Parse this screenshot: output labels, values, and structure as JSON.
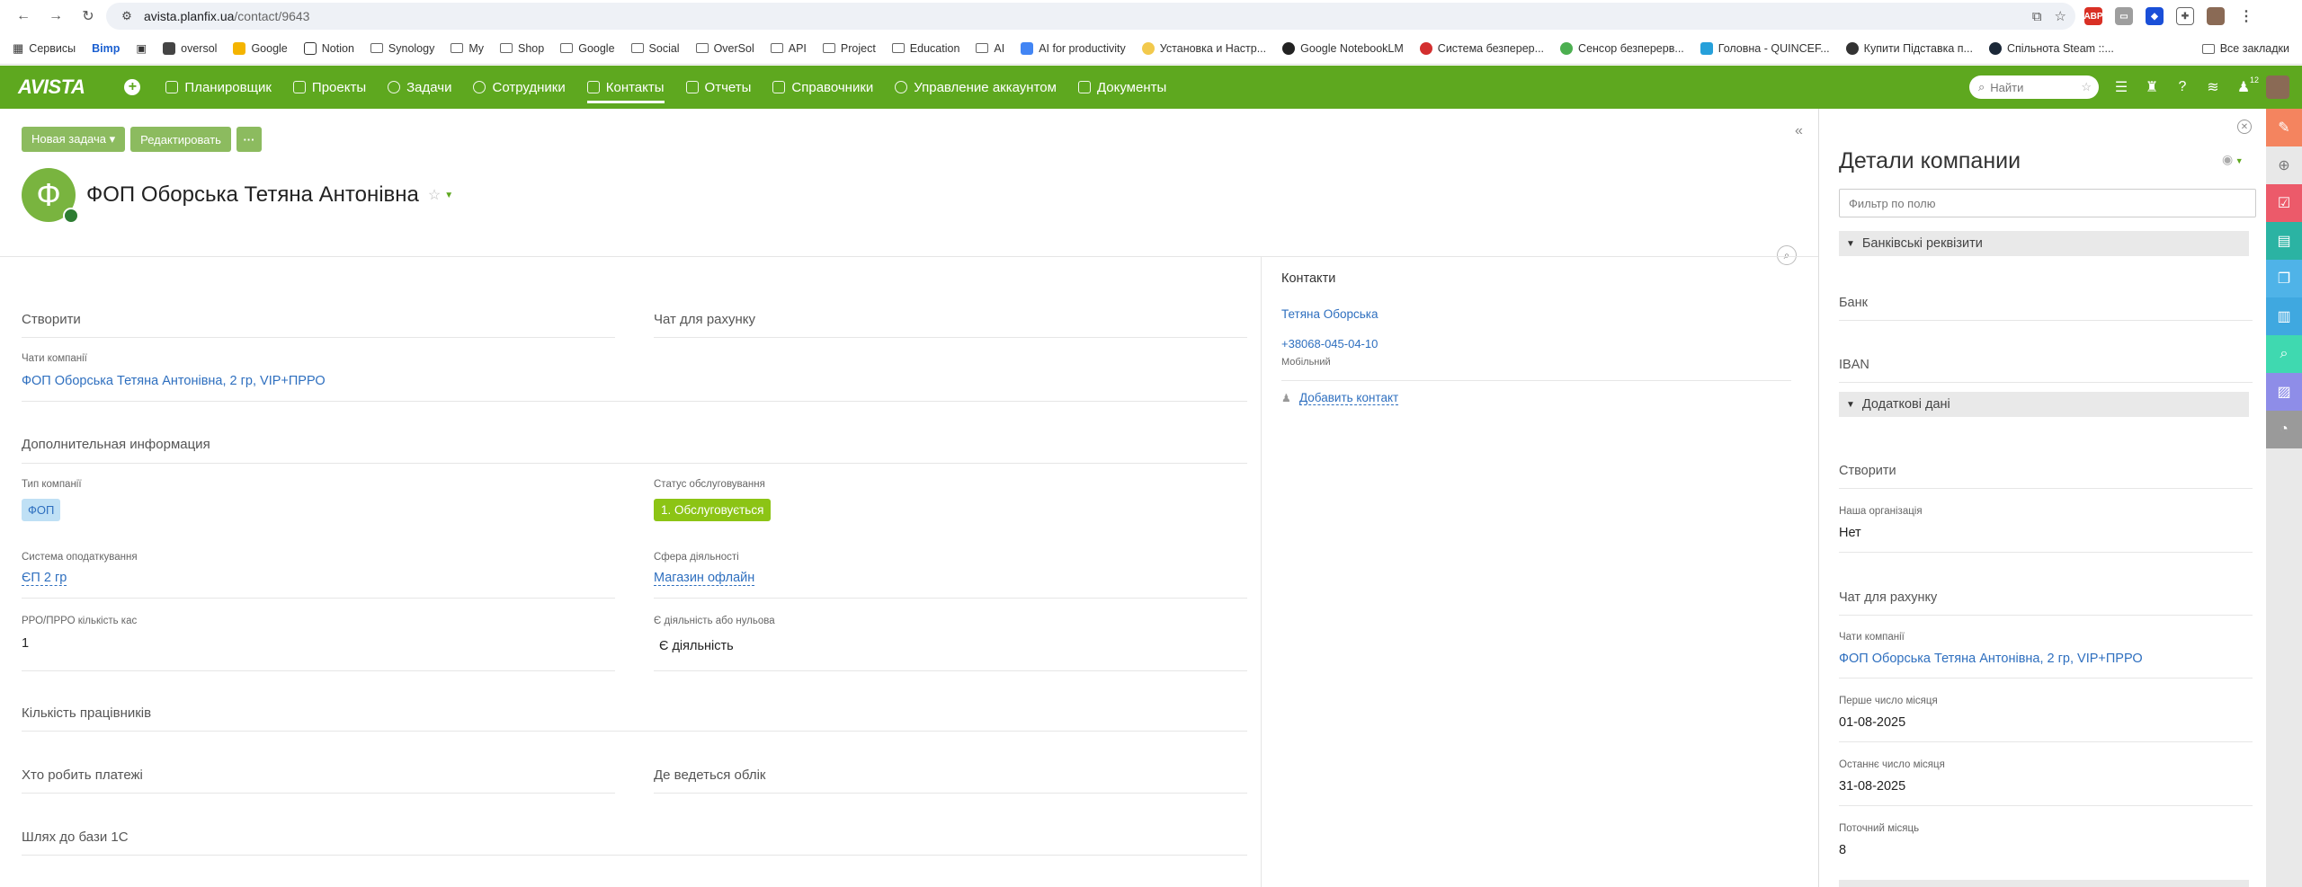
{
  "browser": {
    "url_host": "avista.planfix.ua",
    "url_path": "/contact/9643",
    "bookmarks": [
      "Сервисы",
      "Bimp",
      "oversol",
      "Google",
      "Notion",
      "Synology",
      "My",
      "Shop",
      "Google",
      "Social",
      "OverSol",
      "API",
      "Project",
      "Education",
      "AI",
      "AI for productivity",
      "Установка и Настр...",
      "Google NotebookLM",
      "Система безперер...",
      "Сенсор безперерв...",
      "Головна - QUINCEF...",
      "Купити Підставка п...",
      "Спільнота Steam ::..."
    ],
    "all_bookmarks": "Все закладки"
  },
  "app": {
    "logo": "AVISTA",
    "nav": [
      "Планировщик",
      "Проекты",
      "Задачи",
      "Сотрудники",
      "Контакты",
      "Отчеты",
      "Справочники",
      "Управление аккаунтом",
      "Документы"
    ],
    "active_nav": "Контакты",
    "search_placeholder": "Найти",
    "notif_count": "12",
    "accent_color": "#5ea81f"
  },
  "toolbar": {
    "new_task": "Новая задача ▾",
    "edit": "Редактировать",
    "more": "···"
  },
  "company": {
    "initial": "Ф",
    "name": "ФОП Оборська Тетяна Антонівна"
  },
  "main": {
    "create_title": "Створити",
    "invoice_chat_title": "Чат для рахунку",
    "company_chats_label": "Чати компанії",
    "company_chats_value": "ФОП Оборська Тетяна Антонівна, 2 гр, VIP+ПРРО",
    "extra_title": "Дополнительная информация",
    "company_type_label": "Тип компанії",
    "company_type_value": "ФОП",
    "service_status_label": "Статус обслуговування",
    "service_status_value": "1. Обслуговується",
    "tax_system_label": "Система оподаткування",
    "tax_system_value": "ЄП 2 гр",
    "activity_label": "Сфера діяльності",
    "activity_value": "Магазин офлайн",
    "rro_label": "РРО/ПРРО кількість кас",
    "rro_value": "1",
    "has_activity_label": "Є діяльність або нульова",
    "has_activity_value": "Є діяльність",
    "employees_title": "Кількість працівників",
    "payer_title": "Хто робить платежі",
    "accounting_title": "Де ведеться облік",
    "path_1c_title": "Шлях до бази 1С"
  },
  "contacts": {
    "title": "Контакти",
    "person": "Тетяна Оборська",
    "phone": "+38068-045-04-10",
    "phone_type": "Мобільний",
    "add": "Добавить контакт"
  },
  "panel": {
    "title": "Детали компании",
    "filter_placeholder": "Фильтр по полю",
    "bank_group": "Банківські реквізити",
    "bank_label": "Банк",
    "iban_label": "IBAN",
    "extra_group": "Додаткові дані",
    "create_title": "Створити",
    "our_org_label": "Наша організація",
    "our_org_value": "Нет",
    "invoice_chat_title": "Чат для рахунку",
    "company_chats_label": "Чати компанії",
    "company_chats_value": "ФОП Оборська Тетяна Антонівна, 2 гр, VIP+ПРРО",
    "first_day_label": "Перше число місяця",
    "first_day_value": "01-08-2025",
    "last_day_label": "Останнє число місяця",
    "last_day_value": "31-08-2025",
    "current_month_label": "Поточний місяць",
    "current_month_value": "8"
  },
  "rail_colors": [
    "#f4845f",
    "#e8e8e8",
    "#ec5a6a",
    "#2bb3a3",
    "#4fb3e8",
    "#3fa8e0",
    "#3fd9b0",
    "#8e8de8",
    "#9a9a9a"
  ]
}
